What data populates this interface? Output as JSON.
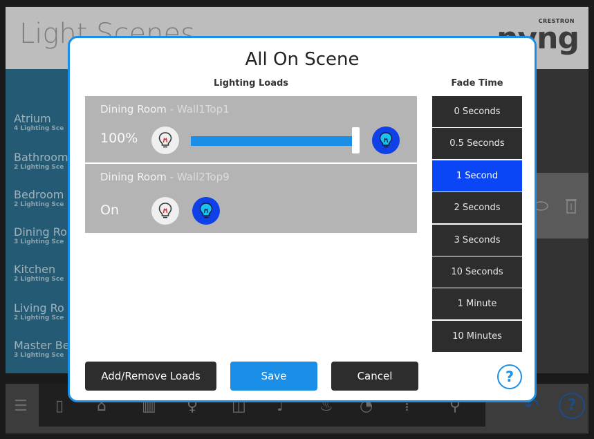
{
  "background": {
    "title": "Light Scenes",
    "brand_small": "CRESTRON",
    "brand": "nyng",
    "rooms": [
      {
        "name": "Atrium",
        "sub": "4 Lighting Sce"
      },
      {
        "name": "Bathroom",
        "sub": "2 Lighting Sce"
      },
      {
        "name": "Bedroom",
        "sub": "2 Lighting Sce"
      },
      {
        "name": "Dining Ro",
        "sub": "3 Lighting Sce"
      },
      {
        "name": "Kitchen",
        "sub": "2 Lighting Sce"
      },
      {
        "name": "Living Ro",
        "sub": "2 Lighting Sce"
      },
      {
        "name": "Master Be",
        "sub": "3 Lighting Sce"
      }
    ],
    "help": "?"
  },
  "modal": {
    "title": "All On Scene",
    "lighting_loads_header": "Lighting Loads",
    "fade_time_header": "Fade Time",
    "loads": [
      {
        "room": "Dining Room",
        "device": " - Wall1Top1",
        "level": "100%",
        "dim_level_percent": 100
      },
      {
        "room": "Dining Room",
        "device": " - Wall2Top9",
        "level": "On"
      }
    ],
    "fade_options": [
      "0 Seconds",
      "0.5 Seconds",
      "1 Second",
      "2 Seconds",
      "3 Seconds",
      "10 Seconds",
      "1 Minute",
      "10 Minutes"
    ],
    "fade_selected": "1 Second",
    "buttons": {
      "add_remove": "Add/Remove Loads",
      "save": "Save",
      "cancel": "Cancel"
    },
    "help": "?"
  },
  "colors": {
    "accent": "#1b8fe8",
    "selected": "#0a46f5",
    "dark_button": "#2d2d2d"
  }
}
